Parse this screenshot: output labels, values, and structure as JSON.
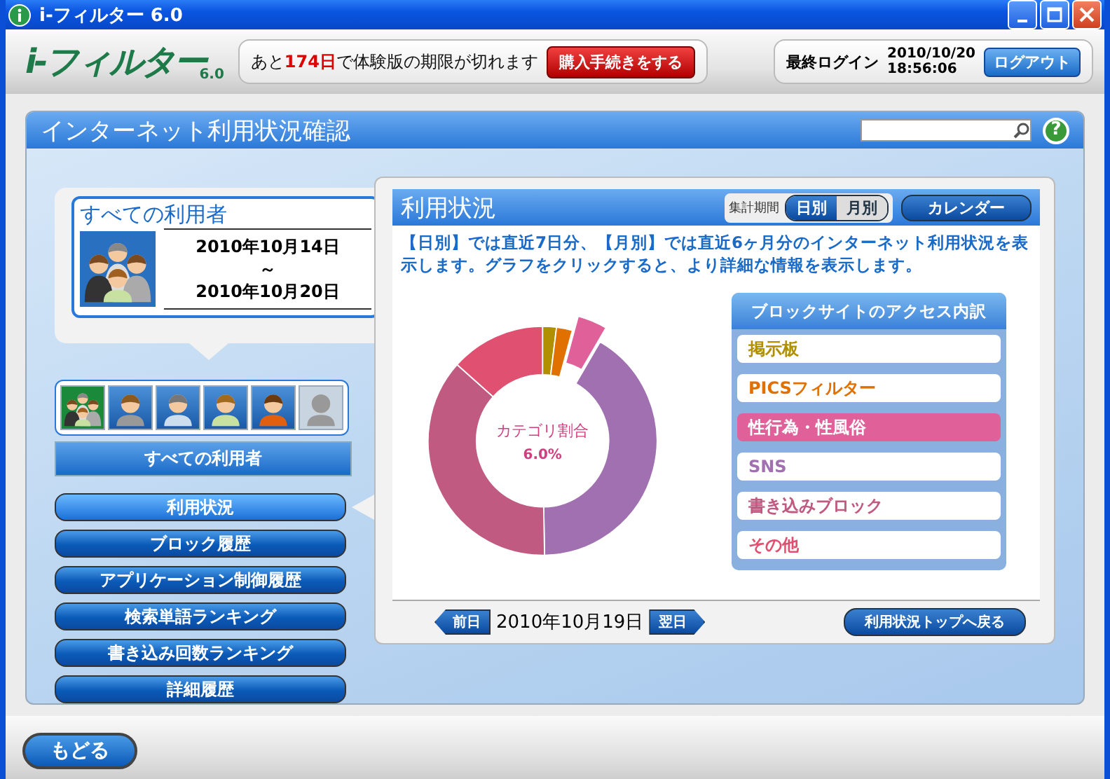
{
  "window": {
    "title": "i-フィルター 6.0"
  },
  "header": {
    "logo": "i-フィルター",
    "logo_version": "6.0",
    "notice_before": "あと",
    "notice_days": "174日",
    "notice_after": "で体験版の期限が切れます",
    "purchase_button": "購入手続きをする",
    "login_label": "最終ログイン",
    "login_date": "2010/10/20",
    "login_time": "18:56:06",
    "logout_button": "ログアウト"
  },
  "page": {
    "title": "インターネット利用状況確認",
    "help_button": "?"
  },
  "user_card": {
    "title": "すべての利用者",
    "date_from": "2010年10月14日",
    "date_sep": "～",
    "date_to": "2010年10月20日"
  },
  "users": [
    {
      "kind": "group",
      "selected": true,
      "disabled": false
    },
    {
      "kind": "woman",
      "selected": false,
      "disabled": false
    },
    {
      "kind": "man",
      "selected": false,
      "disabled": false
    },
    {
      "kind": "girl",
      "selected": false,
      "disabled": false
    },
    {
      "kind": "boy",
      "selected": false,
      "disabled": false
    },
    {
      "kind": "empty",
      "selected": false,
      "disabled": true
    }
  ],
  "selected_user_label": "すべての利用者",
  "nav": [
    {
      "label": "利用状況",
      "selected": true
    },
    {
      "label": "ブロック履歴",
      "selected": false
    },
    {
      "label": "アプリケーション制御履歴",
      "selected": false
    },
    {
      "label": "検索単語ランキング",
      "selected": false
    },
    {
      "label": "書き込み回数ランキング",
      "selected": false
    },
    {
      "label": "詳細履歴",
      "selected": false
    }
  ],
  "usage": {
    "title": "利用状況",
    "period_label": "集計期間",
    "period_tabs": [
      {
        "label": "日別",
        "selected": true
      },
      {
        "label": "月別",
        "selected": false
      }
    ],
    "calendar_button": "カレンダー",
    "description": "【日別】では直近7日分、【月別】では直近6ヶ月分のインターネット利用状況を表示します。グラフをクリックすると、より詳細な情報を表示します。",
    "chart_center_label": "カテゴリ割合",
    "chart_center_value": "6.0%",
    "legend_title": "ブロックサイトのアクセス内訳",
    "legend": [
      {
        "label": "掲示板",
        "color": "#b09000",
        "selected": false
      },
      {
        "label": "PICSフィルター",
        "color": "#e07000",
        "selected": false
      },
      {
        "label": "性行為・性風俗",
        "color": "#e0609a",
        "selected": true
      },
      {
        "label": "SNS",
        "color": "#a070b0",
        "selected": false
      },
      {
        "label": "書き込みブロック",
        "color": "#c05a80",
        "selected": false
      },
      {
        "label": "その他",
        "color": "#e05070",
        "selected": false
      }
    ],
    "prev_button": "前日",
    "date": "2010年10月19日",
    "next_button": "翌日",
    "back_to_top_button": "利用状況トップへ戻る"
  },
  "back_button": "もどる"
}
